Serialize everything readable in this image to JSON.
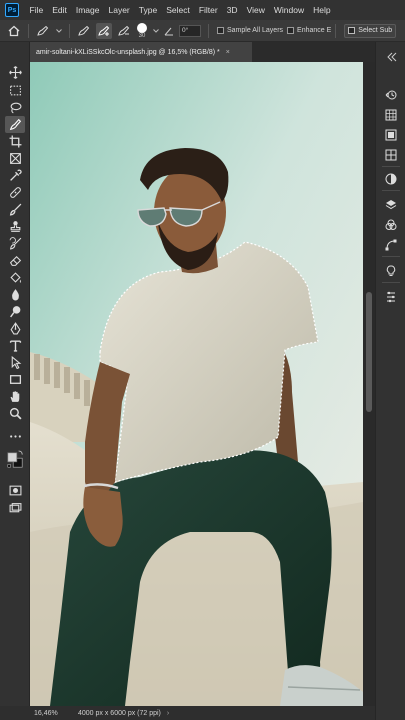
{
  "app": {
    "logo": "Ps"
  },
  "menu": [
    "File",
    "Edit",
    "Image",
    "Layer",
    "Type",
    "Select",
    "Filter",
    "3D",
    "View",
    "Window",
    "Help"
  ],
  "options": {
    "brush_size": "30",
    "angle": "0°",
    "sample_all_layers": "Sample All Layers",
    "enhance_edge": "Enhance E",
    "select_subject": "Select Sub"
  },
  "document": {
    "tab_title": "amir-soltani-kXLiSSkcOlc-unsplash.jpg @ 16,5% (RGB/8) *",
    "close": "×"
  },
  "status": {
    "zoom": "16,46%",
    "doc_info": "4000 px x 6000 px (72 ppi)",
    "chevron": "›"
  },
  "tools": [
    "move-icon",
    "marquee-icon",
    "lasso-icon",
    "quick-selection-icon",
    "crop-icon",
    "frame-icon",
    "eyedropper-icon",
    "healing-brush-icon",
    "brush-icon",
    "clone-stamp-icon",
    "history-brush-icon",
    "eraser-icon",
    "paint-bucket-icon",
    "blur-icon",
    "dodge-icon",
    "pen-icon",
    "type-icon",
    "path-selection-icon",
    "rectangle-icon",
    "hand-icon",
    "zoom-icon",
    "more-tools-icon",
    "color-swatches-icon",
    "quick-mask-icon",
    "screen-mode-icon"
  ],
  "colors": {
    "accent": "#31a8ff",
    "shirt": "#d9d6c8",
    "pants": "#1d3a30",
    "sky": "#a9d4c6"
  }
}
